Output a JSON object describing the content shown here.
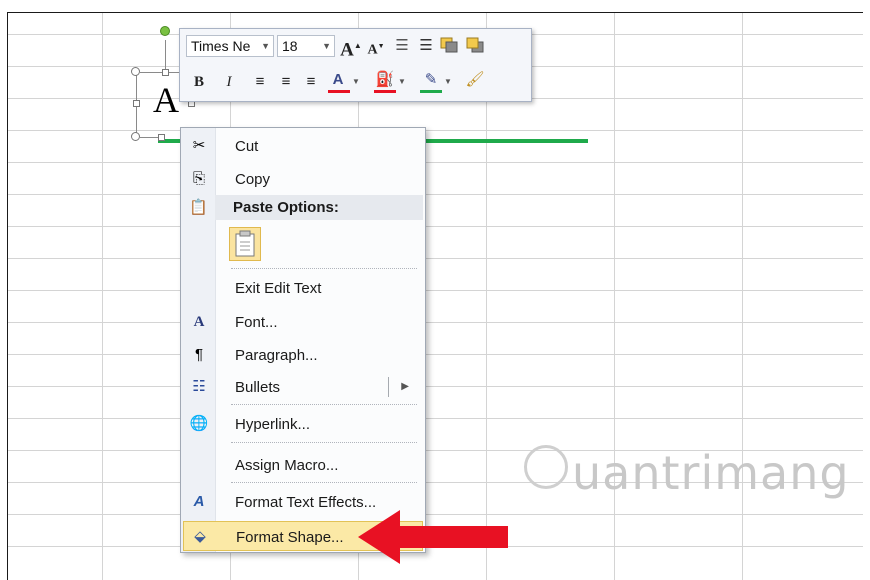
{
  "minitoolbar": {
    "font_name": "Times Ne",
    "font_size": "18",
    "icons": [
      "grow-font-icon",
      "shrink-font-icon",
      "decrease-indent-icon",
      "increase-indent-icon",
      "bring-forward-icon",
      "send-backward-icon",
      "bold-icon",
      "italic-icon",
      "align-left-icon",
      "center-icon",
      "align-right-icon",
      "font-color-icon",
      "shape-fill-icon",
      "shape-outline-icon",
      "format-painter-icon"
    ],
    "glyphs": {
      "grow": "A",
      "shrink": "A",
      "bold": "B",
      "italic": "I",
      "font_color": "A"
    },
    "colors": {
      "font_color_bar": "#e81123",
      "fill_bar": "#e81123",
      "outline_bar": "#1faa4b"
    }
  },
  "shape": {
    "text": "A",
    "line_color": "#1faa4b"
  },
  "context_menu": {
    "items": [
      {
        "id": "cut",
        "label": "Cut",
        "icon": "scissors-icon"
      },
      {
        "id": "copy",
        "label": "Copy",
        "icon": "copy-icon"
      },
      {
        "id": "paste_header",
        "label": "Paste Options:",
        "icon": "paste-icon"
      },
      {
        "id": "exit_edit",
        "label": "Exit Edit Text"
      },
      {
        "id": "font",
        "label": "Font...",
        "icon": "font-icon"
      },
      {
        "id": "paragraph",
        "label": "Paragraph...",
        "icon": "paragraph-icon"
      },
      {
        "id": "bullets",
        "label": "Bullets",
        "icon": "bullets-icon"
      },
      {
        "id": "hyperlink",
        "label": "Hyperlink...",
        "icon": "hyperlink-icon"
      },
      {
        "id": "assign_macro",
        "label": "Assign Macro..."
      },
      {
        "id": "text_effects",
        "label": "Format Text Effects...",
        "icon": "text-effects-icon"
      },
      {
        "id": "format_shape",
        "label": "Format Shape...",
        "icon": "format-shape-icon",
        "highlighted": true
      }
    ]
  },
  "annotation": {
    "arrow_color": "#e81123"
  },
  "watermark": {
    "text": "uantrimang"
  }
}
